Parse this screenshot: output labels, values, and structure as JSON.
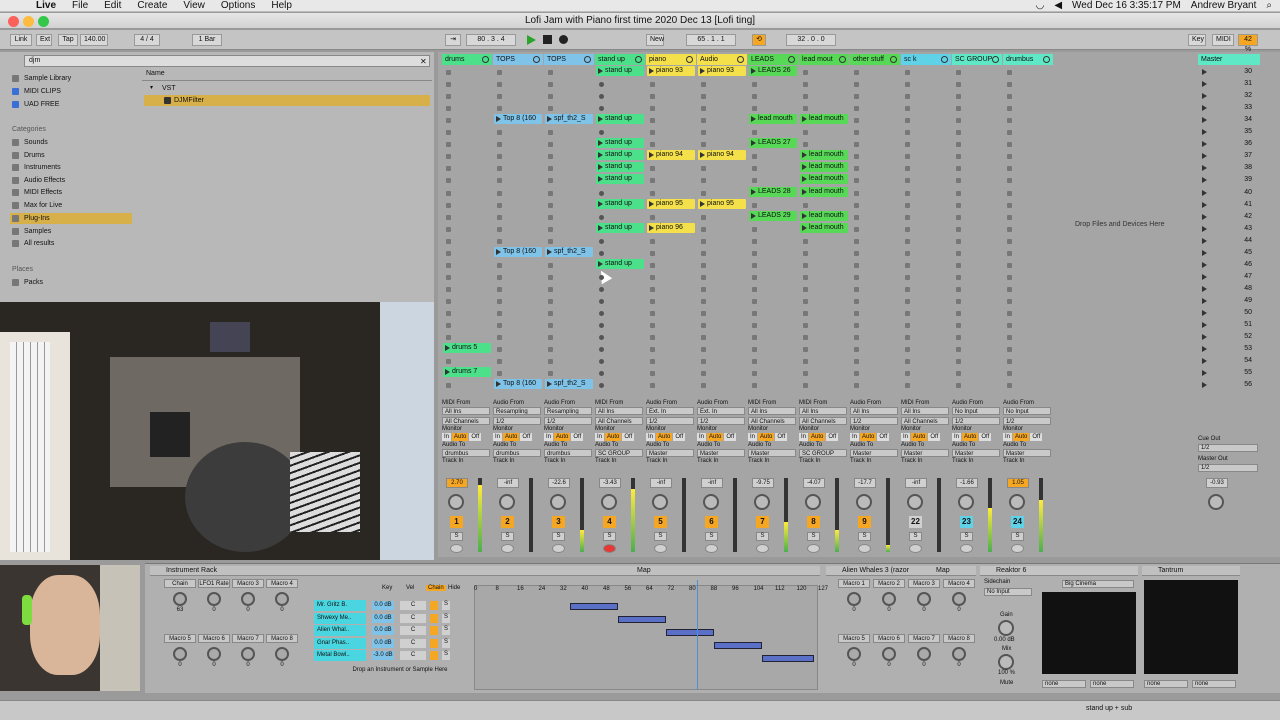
{
  "menubar": {
    "app_name": "Live",
    "items": [
      "File",
      "Edit",
      "Create",
      "View",
      "Options",
      "Help"
    ],
    "clock": "Wed Dec 16  3:35:17 PM",
    "user": "Andrew Bryant"
  },
  "window": {
    "title": "Lofi Jam with Piano first time 2020 Dec 13  [Lofi ting]"
  },
  "control_bar": {
    "link": "Link",
    "ext": "Ext",
    "tap": "Tap",
    "tempo": "140.00",
    "time_sig": "4 / 4",
    "quantize": "1 Bar",
    "arrangement_position": "80 .  3 .  4",
    "new_label": "New",
    "loop_start": "65 .  1 .  1",
    "loop_length": "32 .  0 .  0",
    "key": "Key",
    "midi": "MIDI",
    "cpu": "42 %"
  },
  "browser": {
    "search_value": "djm",
    "collections": [
      "Sample Library",
      "MIDI CLIPS",
      "UAD FREE"
    ],
    "categories_header": "Categories",
    "categories": [
      "Sounds",
      "Drums",
      "Instruments",
      "Audio Effects",
      "MIDI Effects",
      "Max for Live",
      "Plug-Ins",
      "Samples",
      "All results"
    ],
    "places_header": "Places",
    "places": [
      "Packs"
    ],
    "name_header": "Name",
    "results": [
      "VST",
      "DJMFilter"
    ]
  },
  "tracks": [
    {
      "name": "drums",
      "color": "#4de08a",
      "number": "1",
      "volume": "2.70"
    },
    {
      "name": "TOPS",
      "color": "#7fc3e8",
      "number": "2",
      "volume": "-inf"
    },
    {
      "name": "TOPS",
      "color": "#7fc3e8",
      "number": "3",
      "volume": "-22.6"
    },
    {
      "name": "stand up",
      "color": "#4de08a",
      "number": "4",
      "volume": "-3.43"
    },
    {
      "name": "piano",
      "color": "#f3e04a",
      "number": "5",
      "volume": "-inf"
    },
    {
      "name": "Audio",
      "color": "#f3e04a",
      "number": "6",
      "volume": "-inf"
    },
    {
      "name": "LEADS",
      "color": "#57d957",
      "number": "7",
      "volume": "-9.75"
    },
    {
      "name": "lead mout",
      "color": "#57d957",
      "number": "8",
      "volume": "-4.07"
    },
    {
      "name": "other stuff",
      "color": "#57d957",
      "number": "9",
      "volume": "-17.7"
    },
    {
      "name": "sc k",
      "color": "#5fd2e8",
      "number": "22",
      "volume": "-inf"
    },
    {
      "name": "SC GROUP",
      "color": "#5fe8c6",
      "number": "23",
      "volume": "-1.66"
    },
    {
      "name": "drumbus",
      "color": "#5fe8c6",
      "number": "24",
      "volume": "1.05"
    }
  ],
  "clips": [
    {
      "track": 3,
      "row": 0,
      "name": "stand up"
    },
    {
      "track": 4,
      "row": 0,
      "name": "piano 93"
    },
    {
      "track": 5,
      "row": 0,
      "name": "piano 93"
    },
    {
      "track": 6,
      "row": 0,
      "name": "LEADS 26"
    },
    {
      "track": 1,
      "row": 4,
      "name": "Top 8 (160"
    },
    {
      "track": 2,
      "row": 4,
      "name": "spf_th2_S"
    },
    {
      "track": 3,
      "row": 4,
      "name": "stand up"
    },
    {
      "track": 6,
      "row": 4,
      "name": "lead mouth"
    },
    {
      "track": 7,
      "row": 4,
      "name": "lead mouth"
    },
    {
      "track": 3,
      "row": 6,
      "name": "stand up"
    },
    {
      "track": 6,
      "row": 6,
      "name": "LEADS 27"
    },
    {
      "track": 3,
      "row": 7,
      "name": "stand up"
    },
    {
      "track": 4,
      "row": 7,
      "name": "piano 94"
    },
    {
      "track": 5,
      "row": 7,
      "name": "piano 94"
    },
    {
      "track": 7,
      "row": 7,
      "name": "lead mouth"
    },
    {
      "track": 3,
      "row": 8,
      "name": "stand up"
    },
    {
      "track": 7,
      "row": 8,
      "name": "lead mouth"
    },
    {
      "track": 3,
      "row": 9,
      "name": "stand up"
    },
    {
      "track": 7,
      "row": 9,
      "name": "lead mouth"
    },
    {
      "track": 6,
      "row": 10,
      "name": "LEADS 28"
    },
    {
      "track": 7,
      "row": 10,
      "name": "lead mouth"
    },
    {
      "track": 3,
      "row": 11,
      "name": "stand up"
    },
    {
      "track": 4,
      "row": 11,
      "name": "piano 95"
    },
    {
      "track": 5,
      "row": 11,
      "name": "piano 95"
    },
    {
      "track": 6,
      "row": 12,
      "name": "LEADS 29"
    },
    {
      "track": 7,
      "row": 12,
      "name": "lead mouth"
    },
    {
      "track": 3,
      "row": 13,
      "name": "stand up"
    },
    {
      "track": 4,
      "row": 13,
      "name": "piano 96"
    },
    {
      "track": 7,
      "row": 13,
      "name": "lead mouth"
    },
    {
      "track": 1,
      "row": 15,
      "name": "Top 8 (160"
    },
    {
      "track": 2,
      "row": 15,
      "name": "spf_th2_S"
    },
    {
      "track": 3,
      "row": 16,
      "name": "stand up"
    },
    {
      "track": 0,
      "row": 23,
      "name": "drums 5"
    },
    {
      "track": 0,
      "row": 25,
      "name": "drums 7"
    },
    {
      "track": 1,
      "row": 26,
      "name": "Top 8 (160"
    },
    {
      "track": 2,
      "row": 26,
      "name": "spf_th2_S"
    }
  ],
  "scenes": [
    "30",
    "31",
    "32",
    "33",
    "34",
    "35",
    "36",
    "37",
    "38",
    "39",
    "40",
    "41",
    "42",
    "43",
    "44",
    "45",
    "46",
    "47",
    "48",
    "49",
    "50",
    "51",
    "52",
    "53",
    "54",
    "55",
    "56"
  ],
  "master": {
    "name": "Master",
    "volume": "-0.93",
    "cue_out": "Cue Out",
    "cue_value": "1/2",
    "master_out": "Master Out",
    "master_value": "1/2"
  },
  "drop_hint": "Drop Files and Devices Here",
  "io": {
    "midi_from": "MIDI From",
    "audio_from": "Audio From",
    "all_ins": "All Ins",
    "resampling": "Resampling",
    "drumbus": "drumbus",
    "ext_in": "Ext. In",
    "no_input": "No Input",
    "all_channels": "All Channels",
    "ch_1_2": "1/2",
    "monitor": "Monitor",
    "in": "In",
    "auto": "Auto",
    "off": "Off",
    "audio_to": "Audio To",
    "sc_group": "SC GROUP",
    "master": "Master",
    "track_in": "Track In"
  },
  "instrument_rack": {
    "title": "Instrument Rack",
    "map": "Map",
    "key": "Key",
    "vel": "Vel",
    "chain": "Chain",
    "hide": "Hide",
    "macros": [
      "Chain Selector",
      "LFO1 Rate",
      "Macro 3",
      "Macro 4",
      "Macro 5",
      "Macro 6",
      "Macro 7",
      "Macro 8"
    ],
    "macro_values": [
      "63",
      "0",
      "0",
      "0",
      "0",
      "0",
      "0",
      "0"
    ],
    "chains": [
      {
        "name": "Mr. Gritz B.",
        "vol": "0.0 dB",
        "pan": "C"
      },
      {
        "name": "Shwexy Me..",
        "vol": "0.0 dB",
        "pan": "C"
      },
      {
        "name": "Alien Whal..",
        "vol": "0.0 dB",
        "pan": "C"
      },
      {
        "name": "Gnar Phas..",
        "vol": "0.0 dB",
        "pan": "C"
      },
      {
        "name": "Metal Bowl..",
        "vol": "-3.0 dB",
        "pan": "C"
      }
    ],
    "drop_hint": "Drop an Instrument or Sample Here",
    "ruler": [
      "0",
      "8",
      "16",
      "24",
      "32",
      "40",
      "48",
      "56",
      "64",
      "72",
      "80",
      "88",
      "96",
      "104",
      "112",
      "120",
      "127"
    ]
  },
  "alien_whales": {
    "title": "Alien Whales 3 (razor",
    "map": "Map",
    "macros": [
      "Macro 1",
      "Macro 2",
      "Macro 3",
      "Macro 4",
      "Macro 5",
      "Macro 6",
      "Macro 7",
      "Macro 8"
    ],
    "macro_values": [
      "0",
      "0",
      "0",
      "0",
      "0",
      "0",
      "0",
      "0"
    ]
  },
  "reaktor": {
    "title": "Reaktor 6",
    "sidechain": "Sidechain",
    "no_input": "No Input",
    "gain": "Gain",
    "gain_value": "0.00 dB",
    "mix": "Mix",
    "mix_value": "100 %",
    "mute": "Mute",
    "preset": "Big Cinema",
    "none": "none"
  },
  "tantrum": {
    "title": "Tantrum",
    "none": "none"
  },
  "status": {
    "right_text": "stand up + sub"
  }
}
